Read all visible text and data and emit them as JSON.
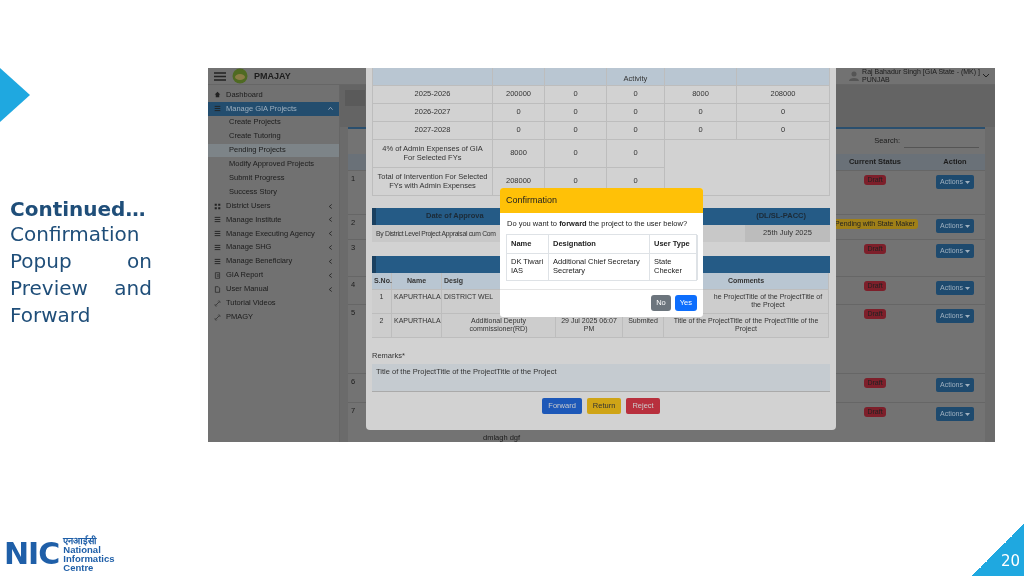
{
  "slide": {
    "heading": "Continued…",
    "subtitle": "Confirmation Popup on Preview and Forward",
    "page_number": "20",
    "logo": {
      "mark": "NIC",
      "hindi": "एनआईसी",
      "lines": [
        "National",
        "Informatics",
        "Centre"
      ]
    }
  },
  "header": {
    "brand": "PMAJAY",
    "user": "Raj Bahadur Singh [GIA State - (MK) ]",
    "user_state": "PUNJAB"
  },
  "sidebar": {
    "items": [
      {
        "label": "Dashboard",
        "kind": "home",
        "selected": false
      },
      {
        "label": "Manage GIA Projects",
        "kind": "list",
        "selected": true,
        "expanded": true,
        "children": [
          {
            "label": "Create Projects",
            "selected": false
          },
          {
            "label": "Create Tutoring",
            "selected": false
          },
          {
            "label": "Pending Projects",
            "selected": true
          },
          {
            "label": "Modify Approved Projects",
            "selected": false
          },
          {
            "label": "Submit Progress",
            "selected": false
          },
          {
            "label": "Success Story",
            "selected": false
          }
        ]
      },
      {
        "label": "District Users",
        "kind": "grid",
        "selected": false,
        "expanded": false
      },
      {
        "label": "Manage Institute",
        "kind": "list",
        "selected": false,
        "expanded": false
      },
      {
        "label": "Manage Executing Agency",
        "kind": "list",
        "selected": false,
        "expanded": false
      },
      {
        "label": "Manage SHG",
        "kind": "list",
        "selected": false,
        "expanded": false
      },
      {
        "label": "Manage Beneficiary",
        "kind": "list",
        "selected": false,
        "expanded": false
      },
      {
        "label": "GIA Report",
        "kind": "report",
        "selected": false,
        "expanded": false
      },
      {
        "label": "User Manual",
        "kind": "doc",
        "selected": false,
        "expanded": false
      },
      {
        "label": "Tutorial Videos",
        "kind": "link",
        "selected": false
      },
      {
        "label": "PMAGY",
        "kind": "link",
        "selected": false
      }
    ]
  },
  "projects": {
    "search_label": "Search:",
    "columns": [
      "Current Status",
      "Action"
    ],
    "rows": [
      {
        "sno": "1",
        "status": "Draft",
        "color": "#7d1f2a",
        "action": "Actions"
      },
      {
        "sno": "2",
        "status": "Pending with State Maker",
        "color": "#a08018",
        "action": "Actions"
      },
      {
        "sno": "3",
        "status": "Draft",
        "color": "#7d1f2a",
        "action": "Actions"
      },
      {
        "sno": "4",
        "status": "Draft",
        "color": "#7d1f2a",
        "action": "Actions"
      },
      {
        "sno": "5",
        "status": "Draft",
        "color": "#7d1f2a",
        "action": "Actions"
      },
      {
        "sno": "6",
        "status": "Draft",
        "color": "#7d1f2a",
        "action": "Actions"
      },
      {
        "sno": "7",
        "status": "Draft",
        "color": "#7d1f2a",
        "action": "Actions",
        "extra": "dmlagh dgf"
      }
    ]
  },
  "preview": {
    "funding": {
      "column_4_heading": "Activity",
      "rows": [
        [
          "2025-2026",
          "200000",
          "0",
          "0",
          "8000",
          "208000"
        ],
        [
          "2026-2027",
          "0",
          "0",
          "0",
          "0",
          "0"
        ],
        [
          "2027-2028",
          "0",
          "0",
          "0",
          "0",
          "0"
        ],
        [
          "4% of Admin Expenses of GIA For Selected FYs",
          "8000",
          "0",
          "0"
        ],
        [
          "Total of Intervention For Selected FYs with Admin Expenses",
          "208000",
          "0",
          "0"
        ]
      ]
    },
    "approval": {
      "heading_left": "Date of Approva",
      "heading_right": "(DL/SL-PACC)",
      "body": "By District Level Project Appraisal cum Com",
      "date": "25th July 2025"
    },
    "history": {
      "columns": [
        "S.No.",
        "Name",
        "Desig",
        "Comments"
      ],
      "rows": [
        {
          "sno": "1",
          "name": "KAPURTHALA",
          "designation": "DISTRICT WEL",
          "comments": "he ProjectTitle of the ProjectTitle of the Project"
        },
        {
          "sno": "2",
          "name": "KAPURTHALA",
          "designation": "Additional Deputy commissioner(RD)",
          "date": "29 Jul 2025 06:07 PM",
          "status": "Submited",
          "comments": "Title of the ProjectTitle of the ProjectTitle of the Project"
        }
      ]
    },
    "remarks_label": "Remarks*",
    "remarks": "Title of the ProjectTitle of the ProjectTitle of the Project",
    "buttons": [
      {
        "label": "Forward",
        "color": "#1d58b8"
      },
      {
        "label": "Return",
        "color": "#cfa416"
      },
      {
        "label": "Reject",
        "color": "#b8303d"
      }
    ]
  },
  "confirm": {
    "title": "Confirmation",
    "message": "Do you want to **forward** the project to the user below?",
    "columns": [
      "Name",
      "Designation",
      "User Type"
    ],
    "rows": [
      [
        "DK Tiwari IAS",
        "Additional Chief Secretary Secretary",
        "State Checker"
      ]
    ],
    "buttons": [
      {
        "label": "No",
        "kind": "secondary"
      },
      {
        "label": "Yes",
        "kind": "primary"
      }
    ]
  }
}
